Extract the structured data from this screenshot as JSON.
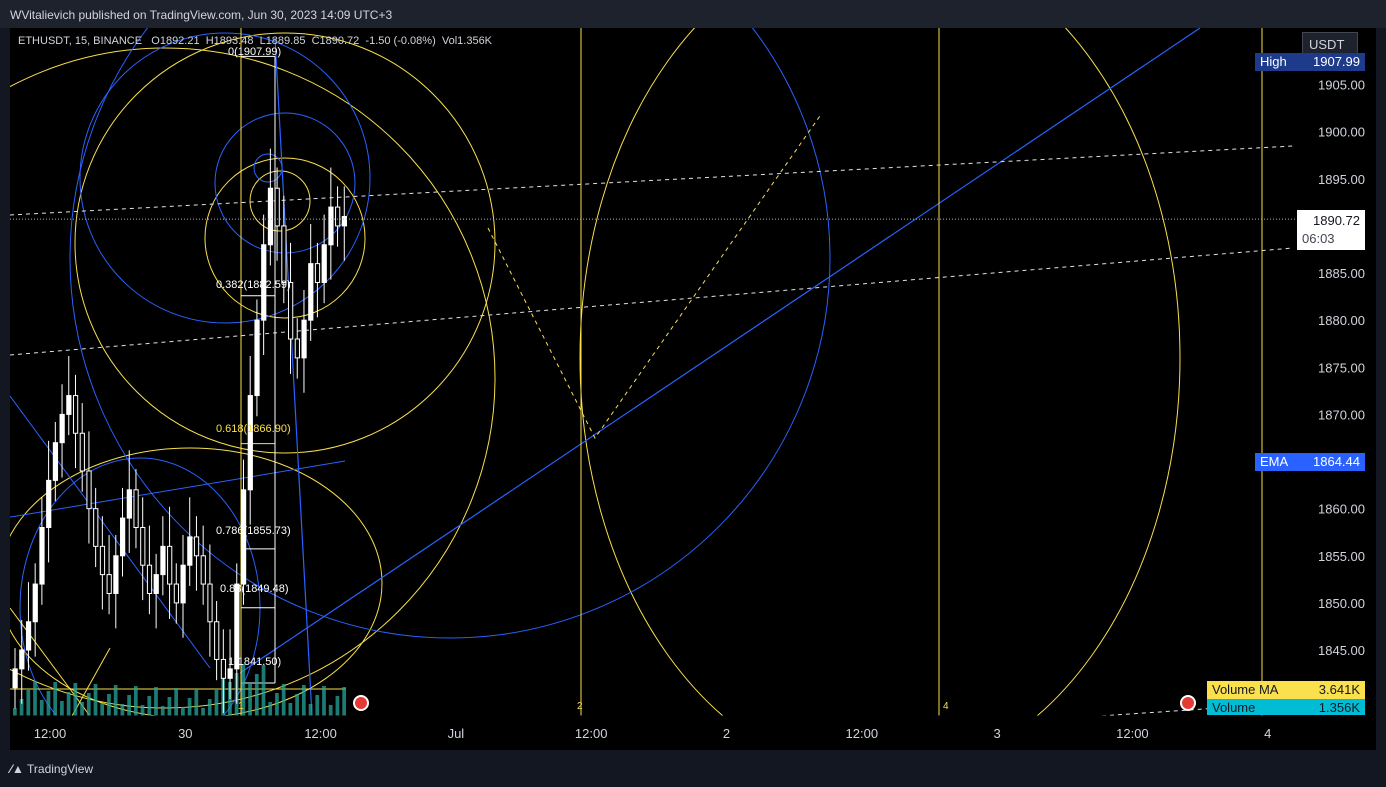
{
  "header": {
    "published": "WVitalievich published on TradingView.com, Jun 30, 2023 14:09 UTC+3"
  },
  "legend": {
    "symbol": "ETHUSDT, 15, BINANCE",
    "open_label": "O",
    "open": "1892.21",
    "high_label": "H",
    "high": "1893.48",
    "low_label": "L",
    "low": "1889.85",
    "close_label": "C",
    "close": "1890.72",
    "change": "-1.50 (-0.08%)",
    "vol_label": "Vol",
    "vol": "1.356K"
  },
  "currency": "USDT",
  "tags": {
    "high_label": "High",
    "high_value": "1907.99",
    "price_value": "1890.72",
    "price_timer": "06:03",
    "ema_label": "EMA",
    "ema_value": "1864.44",
    "volma_label": "Volume MA",
    "volma_value": "3.641K",
    "volume_label": "Volume",
    "volume_value": "1.356K"
  },
  "fib_labels": [
    {
      "text": "0(1907.99)",
      "level": 1907.99
    },
    {
      "text": "0.382(1882.59)",
      "level": 1882.59
    },
    {
      "text": "0.618(1866.90)",
      "level": 1866.9,
      "color": "#f9e04c"
    },
    {
      "text": "0.786(1855.73)",
      "level": 1855.73
    },
    {
      "text": "0.88(1849.48)",
      "level": 1849.48
    },
    {
      "text": "1(1841.50)",
      "level": 1841.5
    }
  ],
  "cycle_labels": [
    "1",
    "2",
    "4"
  ],
  "footer": {
    "brand": "TradingView"
  },
  "colors": {
    "up": "#ffffff",
    "accent_yellow": "#f9e04c",
    "accent_blue": "#2962ff",
    "volume": "#26a69a",
    "ema_tag": "#2962ff",
    "high_tag": "#1e3a8a",
    "volma_tag": "#f9e04c",
    "volume_tag": "#00bcd4"
  },
  "chart_data": {
    "type": "candlestick",
    "x_ticks": [
      "12:00",
      "30",
      "12:00",
      "Jul",
      "12:00",
      "2",
      "12:00",
      "3",
      "12:00",
      "4"
    ],
    "y_ticks": [
      1905.0,
      1900.0,
      1895.0,
      1890.0,
      1885.0,
      1880.0,
      1875.0,
      1870.0,
      1865.0,
      1860.0,
      1855.0,
      1850.0,
      1845.0
    ],
    "y_ticks_text": [
      "1905.00",
      "1900.00",
      "1895.00",
      "1885.00",
      "1880.00",
      "1875.00",
      "1870.00",
      "1860.00",
      "1855.00",
      "1850.00",
      "1845.00"
    ],
    "ylim": [
      1838,
      1911
    ],
    "last_price": 1890.72,
    "ema": 1864.44,
    "high": 1907.99,
    "close_series": [
      1843,
      1845,
      1848,
      1852,
      1858,
      1863,
      1867,
      1870,
      1872,
      1868,
      1864,
      1860,
      1856,
      1853,
      1851,
      1855,
      1859,
      1862,
      1858,
      1854,
      1851,
      1853,
      1856,
      1852,
      1850,
      1854,
      1857,
      1855,
      1852,
      1848,
      1844,
      1842,
      1843,
      1852,
      1862,
      1872,
      1880,
      1888,
      1894,
      1890,
      1884,
      1878,
      1876,
      1880,
      1886,
      1884,
      1888,
      1892,
      1890,
      1891
    ]
  }
}
